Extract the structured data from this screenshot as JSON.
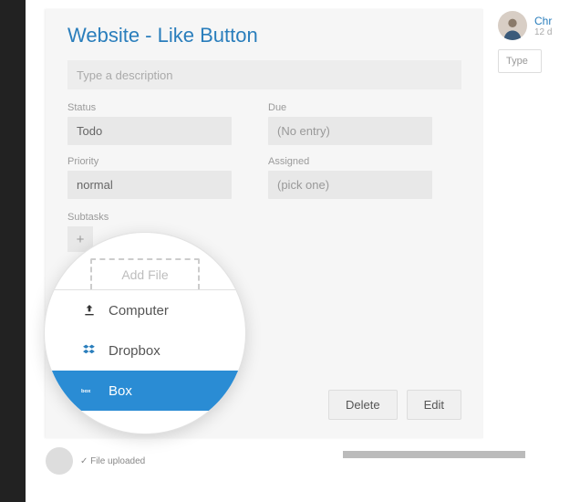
{
  "title": "Website - Like Button",
  "description_placeholder": "Type a description",
  "fields": {
    "status_label": "Status",
    "status_value": "Todo",
    "due_label": "Due",
    "due_value": "(No entry)",
    "priority_label": "Priority",
    "priority_value": "normal",
    "assigned_label": "Assigned",
    "assigned_value": "(pick one)"
  },
  "subtasks_label": "Subtasks",
  "add_subtask_symbol": "+",
  "buttons": {
    "delete": "Delete",
    "edit": "Edit"
  },
  "right": {
    "user_name": "Chr",
    "user_sub": "12 d",
    "type_placeholder": "Type"
  },
  "bottom": {
    "file_uploaded": "✓ File uploaded"
  },
  "zoom": {
    "add_file": "Add File",
    "items": {
      "computer": "Computer",
      "dropbox": "Dropbox",
      "box": "Box"
    }
  }
}
